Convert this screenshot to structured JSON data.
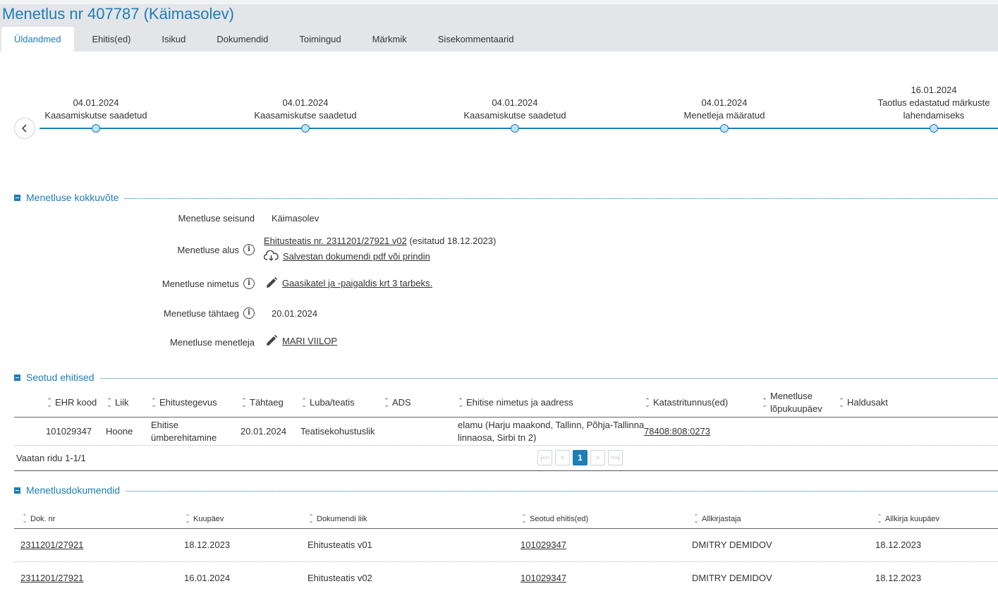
{
  "header": {
    "title": "Menetlus nr 407787 (Käimasolev)",
    "tabs": [
      "Üldandmed",
      "Ehitis(ed)",
      "Isikud",
      "Dokumendid",
      "Toimingud",
      "Märkmik",
      "Sisekommentaarid"
    ]
  },
  "timeline": {
    "events": [
      {
        "date": "04.01.2024",
        "label": "Kaasamiskutse saadetud"
      },
      {
        "date": "04.01.2024",
        "label": "Kaasamiskutse saadetud"
      },
      {
        "date": "04.01.2024",
        "label": "Kaasamiskutse saadetud"
      },
      {
        "date": "04.01.2024",
        "label": "Menetleja määratud"
      },
      {
        "date": "16.01.2024",
        "label_line1": "Taotlus edastatud märkuste",
        "label_line2": "lahendamiseks"
      }
    ]
  },
  "summary": {
    "section_title": "Menetluse kokkuvõte",
    "seisund_label": "Menetluse seisund",
    "seisund_value": "Käimasolev",
    "alus_label": "Menetluse alus",
    "alus_link": "Ehitusteatis nr. 2311201/27921 v02",
    "alus_suffix": " (esitatud 18.12.2023)",
    "alus_download": "Salvestan dokumendi pdf või prindin",
    "nimetus_label": "Menetluse nimetus",
    "nimetus_value": "Gaasikatel ja -paigaldis krt 3 tarbeks.",
    "tahtaeg_label": "Menetluse tähtaeg",
    "tahtaeg_value": "20.01.2024",
    "menetleja_label": "Menetluse menetleja",
    "menetleja_value": "MARI VIILOP"
  },
  "buildings": {
    "section_title": "Seotud ehitised",
    "columns": [
      "EHR kood",
      "Liik",
      "Ehitustegevus",
      "Tähtaeg",
      "Luba/teatis",
      "ADS",
      "Ehitise nimetus ja aadress",
      "Katastritunnus(ed)",
      "Menetluse",
      "lõpukuupäev",
      "Haldusakt"
    ],
    "row": {
      "ehr": "101029347",
      "liik": "Hoone",
      "tegevus1": "Ehitise",
      "tegevus2": "ümberehitamine",
      "tahtaeg": "20.01.2024",
      "luba": "Teatisekohustuslik",
      "nimi1": "elamu (Harju maakond, Tallinn, Põhja-Tallinna",
      "nimi2": "linnaosa, Sirbi tn 2)",
      "kataster": "78408:808:0273"
    },
    "rows_info": "Vaatan ridu 1-1/1",
    "page": "1"
  },
  "documents": {
    "section_title": "Menetlusdokumendid",
    "columns": [
      "Dok. nr",
      "Kuupäev",
      "Dokumendi liik",
      "Seotud ehitis(ed)",
      "Allkirjastaja",
      "Allkirja kuupäev"
    ],
    "rows": [
      {
        "nr": "2311201/27921",
        "kuupaev": "18.12.2023",
        "liik": "Ehitusteatis v01",
        "ehitis": "101029347",
        "allkirjastaja": "DMITRY DEMIDOV",
        "allkirja_kuupaev": "18.12.2023"
      },
      {
        "nr": "2311201/27921",
        "kuupaev": "16.01.2024",
        "liik": "Ehitusteatis v02",
        "ehitis": "101029347",
        "allkirjastaja": "DMITRY DEMIDOV",
        "allkirja_kuupaev": "18.12.2023"
      }
    ]
  },
  "colors": {
    "accent": "#1f7db5",
    "header_bg": "#e3e5e8",
    "dot_fill": "#bfe3f5"
  }
}
